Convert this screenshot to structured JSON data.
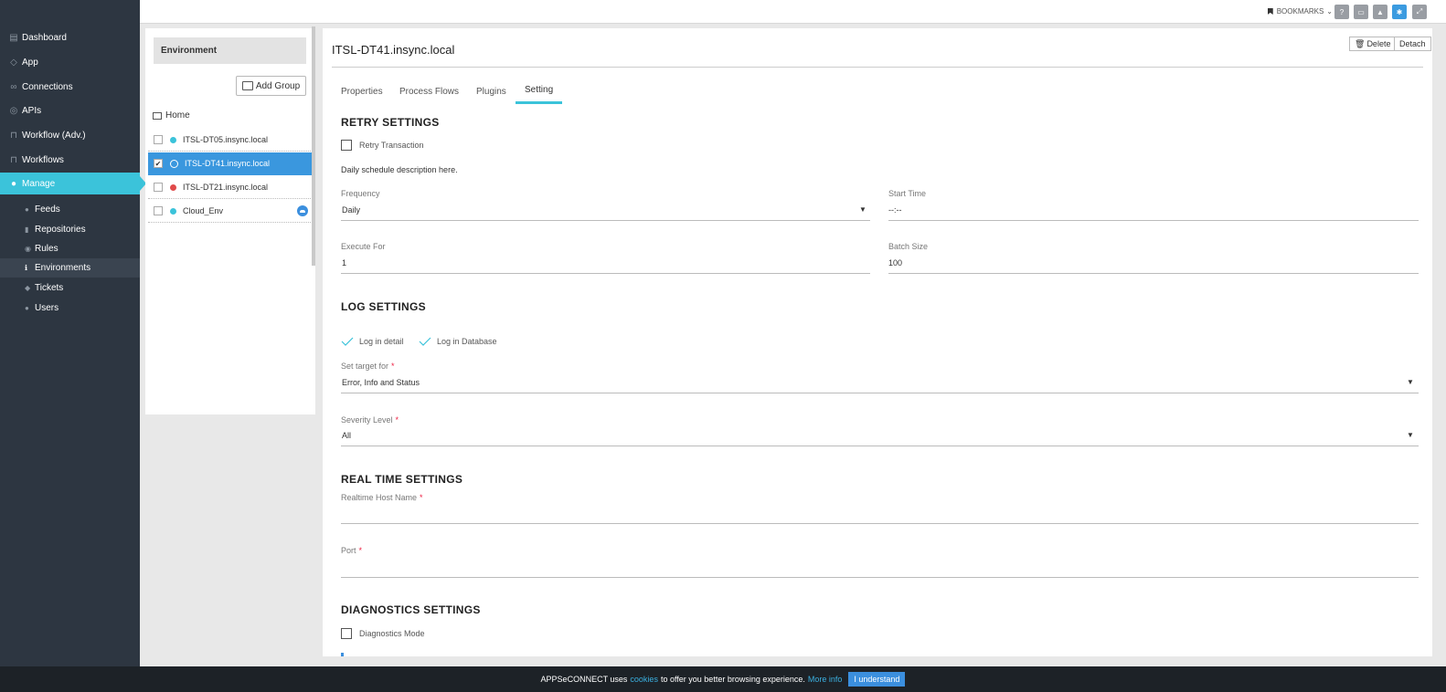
{
  "sidebar": {
    "items": [
      {
        "label": "Dashboard",
        "icon": "dashboard-icon"
      },
      {
        "label": "App",
        "icon": "app-icon"
      },
      {
        "label": "Connections",
        "icon": "connections-icon"
      },
      {
        "label": "APIs",
        "icon": "apis-icon"
      },
      {
        "label": "Workflow (Adv.)",
        "icon": "workflow-icon"
      },
      {
        "label": "Workflows",
        "icon": "workflows-icon"
      },
      {
        "label": "Manage",
        "icon": "manage-icon"
      }
    ],
    "subitems": [
      {
        "label": "Feeds",
        "icon": "feeds-icon"
      },
      {
        "label": "Repositories",
        "icon": "repositories-icon"
      },
      {
        "label": "Rules",
        "icon": "rules-icon"
      },
      {
        "label": "Environments",
        "icon": "info-icon"
      },
      {
        "label": "Tickets",
        "icon": "tickets-icon"
      },
      {
        "label": "Users",
        "icon": "users-icon"
      }
    ],
    "active_item": "Manage",
    "active_subitem": "Environments"
  },
  "topbar": {
    "bookmarks_label": "BOOKMARKS",
    "icons": [
      "help-icon",
      "chat-icon",
      "bell-icon",
      "settings-icon",
      "expand-icon"
    ]
  },
  "env_panel": {
    "header": "Environment",
    "add_group_label": "Add Group",
    "home_label": "Home",
    "rows": [
      {
        "name": "ITSL-DT05.insync.local",
        "status_color": "#3bc3da",
        "checked": false
      },
      {
        "name": "ITSL-DT41.insync.local",
        "status_color": "#3bc3da",
        "checked": true
      },
      {
        "name": "ITSL-DT21.insync.local",
        "status_color": "#e04a4a",
        "checked": false
      },
      {
        "name": "Cloud_Env",
        "status_color": "#3bc3da",
        "checked": false
      }
    ]
  },
  "main": {
    "title": "ITSL-DT41.insync.local",
    "delete_label": "Delete",
    "detach_label": "Detach",
    "tabs": [
      "Properties",
      "Process Flows",
      "Plugins",
      "Setting"
    ],
    "active_tab": "Setting",
    "retry": {
      "heading": "RETRY SETTINGS",
      "retry_label": "Retry Transaction",
      "schedule_note": "Daily schedule description here.",
      "frequency_label": "Frequency",
      "frequency_value": "Daily",
      "start_time_label": "Start Time",
      "start_time_value": "--:--",
      "execute_for_label": "Execute For",
      "execute_for_value": "1",
      "batch_size_label": "Batch Size",
      "batch_size_value": "100"
    },
    "log": {
      "heading": "LOG SETTINGS",
      "log_detail_label": "Log in detail",
      "log_db_label": "Log in Database",
      "target_label": "Set target for",
      "target_value": "Error, Info and Status",
      "severity_label": "Severity Level",
      "severity_value": "All"
    },
    "realtime": {
      "heading": "REAL TIME SETTINGS",
      "host_label": "Realtime Host Name",
      "host_value": "",
      "port_label": "Port",
      "port_value": ""
    },
    "diagnostics": {
      "heading": "DIAGNOSTICS SETTINGS",
      "mode_label": "Diagnostics Mode"
    },
    "required_mark": "*"
  },
  "cookie": {
    "prefix": "APPSeCONNECT uses",
    "cookies_link": "cookies",
    "middle": "to offer you better browsing experience.",
    "more_info": "More info",
    "button": "I understand"
  },
  "colors": {
    "sidebar_bg": "#2d3641",
    "accent": "#3bc3da",
    "selection": "#3a97de"
  }
}
